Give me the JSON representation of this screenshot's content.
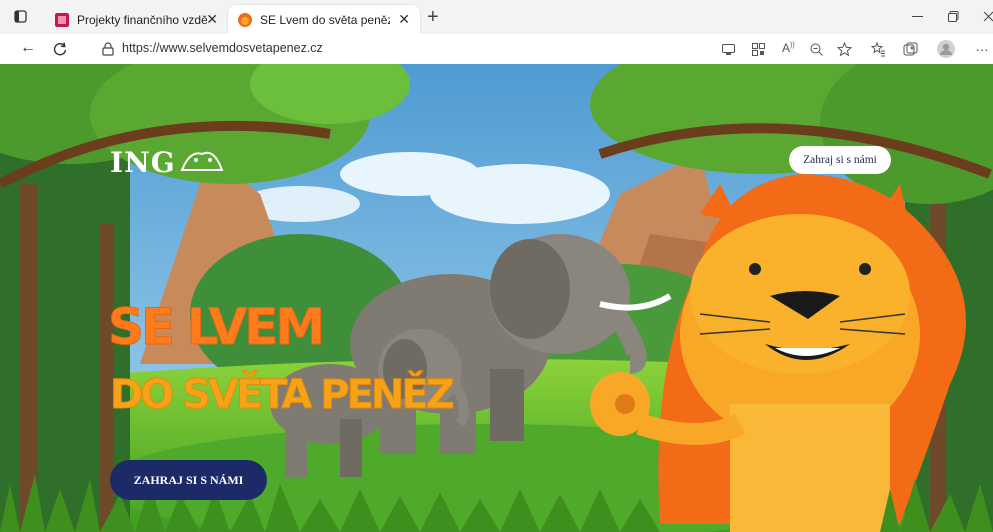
{
  "browser": {
    "tabs": [
      {
        "title": "Projekty finančního vzdělávání | ",
        "active": false
      },
      {
        "title": "SE Lvem do světa peněz",
        "active": true
      }
    ],
    "close_glyph": "✕",
    "new_tab_glyph": "+",
    "url": "https://www.selvemdosvetapenez.cz",
    "back_glyph": "←",
    "reload_glyph": "C",
    "more_glyph": "…"
  },
  "page": {
    "logo_text": "ING",
    "header_button": "Zahraj si s námi",
    "hero_line1": "SE LVEM",
    "hero_line2": "DO SVĚTA PENĚZ",
    "cta_button": "ZAHRAJ SI S NÁMI"
  },
  "colors": {
    "sky": "#5ca7d9",
    "grass": "#5ebd2c",
    "hero_orange": "#ff7c1c",
    "hero_yellow": "#f7a318",
    "cta_navy": "#1d2a68",
    "lion_mane": "#f36b17",
    "lion_face": "#f8a826"
  }
}
